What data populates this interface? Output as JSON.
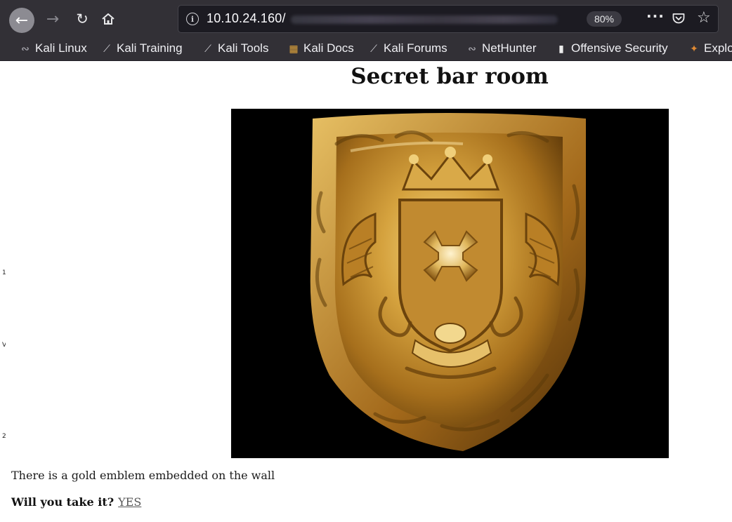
{
  "browser": {
    "url": "10.10.24.160/",
    "zoom": "80%",
    "bookmarks": [
      {
        "label": "Kali Linux",
        "icon": "kali-dragon-icon"
      },
      {
        "label": "Kali Training",
        "icon": "kali-knife-icon"
      },
      {
        "label": "Kali Tools",
        "icon": "kali-knife-icon"
      },
      {
        "label": "Kali Docs",
        "icon": "kali-docs-icon"
      },
      {
        "label": "Kali Forums",
        "icon": "kali-knife-icon"
      },
      {
        "label": "NetHunter",
        "icon": "kali-dragon-icon"
      },
      {
        "label": "Offensive Security",
        "icon": "offsec-icon"
      },
      {
        "label": "Explo",
        "icon": "exploit-db-icon"
      }
    ]
  },
  "page": {
    "title": "Secret bar room",
    "emblem_alt": "gold emblem",
    "description": "There is a gold emblem embedded on the wall",
    "question": "Will you take it?",
    "link_label": "YES"
  },
  "colors": {
    "toolbar": "#323036",
    "urlbar": "#1c1b22",
    "gold": "#c9962f",
    "link": "#555555"
  }
}
